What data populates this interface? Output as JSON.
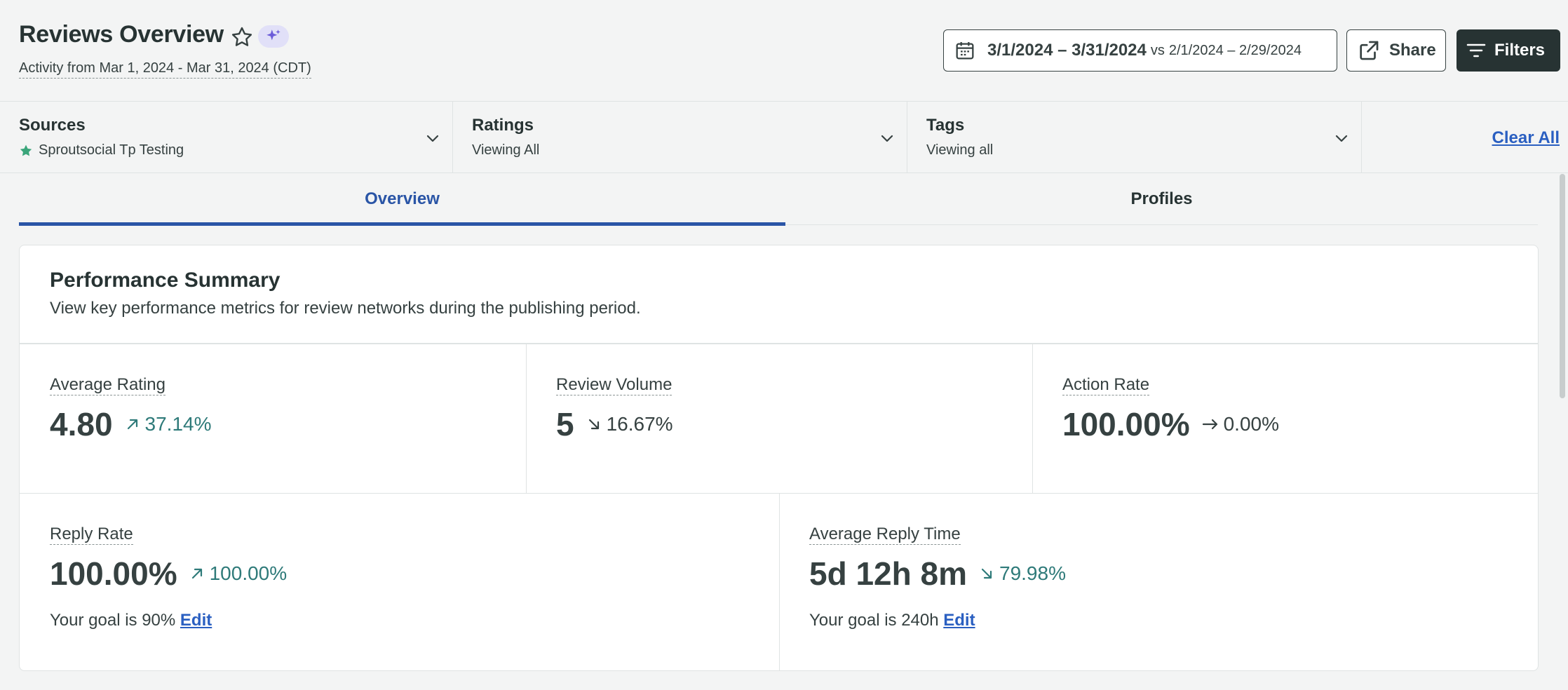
{
  "header": {
    "title": "Reviews Overview",
    "subtitle": "Activity from Mar 1, 2024 - Mar 31, 2024 (CDT)",
    "date_range": "3/1/2024 – 3/31/2024",
    "compare_prefix": "vs",
    "compare_range": "2/1/2024 – 2/29/2024",
    "share_label": "Share",
    "filters_label": "Filters"
  },
  "filters": {
    "sources": {
      "label": "Sources",
      "value": "Sproutsocial Tp Testing"
    },
    "ratings": {
      "label": "Ratings",
      "value": "Viewing All"
    },
    "tags": {
      "label": "Tags",
      "value": "Viewing all"
    },
    "clear_all": "Clear All"
  },
  "tabs": [
    {
      "label": "Overview",
      "active": true
    },
    {
      "label": "Profiles",
      "active": false
    }
  ],
  "summary": {
    "title": "Performance Summary",
    "description": "View key performance metrics for review networks during the publishing period.",
    "metrics": [
      {
        "label": "Average Rating",
        "value": "4.80",
        "change": "37.14%",
        "direction": "up"
      },
      {
        "label": "Review Volume",
        "value": "5",
        "change": "16.67%",
        "direction": "down"
      },
      {
        "label": "Action Rate",
        "value": "100.00%",
        "change": "0.00%",
        "direction": "flat"
      },
      {
        "label": "Reply Rate",
        "value": "100.00%",
        "change": "100.00%",
        "direction": "up",
        "goal_text": "Your goal is 90%",
        "edit_label": "Edit"
      },
      {
        "label": "Average Reply Time",
        "value": "5d 12h 8m",
        "change": "79.98%",
        "direction": "down",
        "goal_text": "Your goal is 240h",
        "edit_label": "Edit"
      }
    ]
  },
  "colors": {
    "accent_blue": "#2a55a6",
    "link_blue": "#2a5fc1",
    "positive_teal": "#2e7a79",
    "dark_button": "#273333",
    "source_star_green": "#3aa57a",
    "ai_badge_bg": "#e1e0f8",
    "ai_badge_icon": "#6b5cd9"
  }
}
